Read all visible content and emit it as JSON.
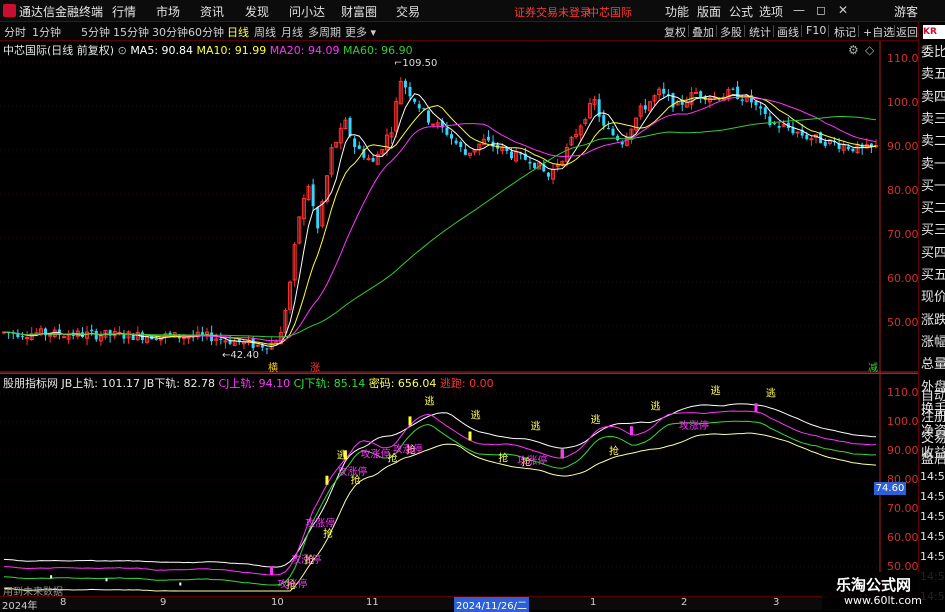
{
  "app": {
    "title": "通达信金融终端"
  },
  "menu": {
    "items": [
      "行情",
      "市场",
      "资讯",
      "发现",
      "问小达",
      "财富圈",
      "交易"
    ],
    "warning": "证券交易未登录",
    "stock_link": "中芯国际",
    "right_items": [
      "功能",
      "版面",
      "公式",
      "选项"
    ],
    "guest": "游客"
  },
  "periods": {
    "tabs": [
      "分时",
      "1分钟",
      "5分钟",
      "15分钟",
      "30分钟",
      "60分钟",
      "日线",
      "周线",
      "月线",
      "多周期",
      "更多"
    ],
    "active": "日线"
  },
  "toolbar_right": [
    "复权",
    "叠加",
    "多股",
    "统计",
    "画线",
    "F10",
    "标记",
    "+自选",
    "返回"
  ],
  "main_legend": {
    "name": "中芯国际(日线 前复权)",
    "ma5": "MA5: 90.84",
    "ma10": "MA10: 91.99",
    "ma20": "MA20: 94.09",
    "ma60": "MA60: 96.90"
  },
  "price_axis": [
    "110.0",
    "100.0",
    "90.00",
    "80.00",
    "70.00",
    "60.00",
    "50.00"
  ],
  "annotations": {
    "high": "109.50",
    "low": "42.40",
    "tag1": "横",
    "tag2": "涨",
    "tag3": "减"
  },
  "sub_legend": {
    "name": "股朋指标网",
    "jb_up": "JB上轨: 101.17",
    "jb_down": "JB下轨: 82.78",
    "cj_up": "CJ上轨: 94.10",
    "cj_down": "CJ下轨: 85.14",
    "secret": "密码: 656.04",
    "escape": "逃跑: 0.00"
  },
  "sub_axis": [
    "110.0",
    "100.0",
    "90.00",
    "80.00",
    "70.00",
    "60.00",
    "50.00"
  ],
  "sub_value_box": "74.60",
  "sub_labels": {
    "escape": "逃",
    "buy": "抢",
    "chase": "攻涨停"
  },
  "dates": [
    "2024年",
    "8",
    "9",
    "10",
    "11",
    "2024/11/26/二",
    "1",
    "2",
    "3"
  ],
  "right_panel": {
    "badge": "KR",
    "rows": [
      "委比",
      "卖五",
      "卖四",
      "卖三",
      "卖二",
      "卖一",
      "买一",
      "买二",
      "买三",
      "买四",
      "买五",
      "现价",
      "涨跌",
      "涨幅",
      "总量",
      "外盘",
      "换手",
      "净资",
      "收益"
    ],
    "lower_rows": [
      "自动",
      "注册",
      "交易",
      "盘后"
    ],
    "times": [
      "14:5",
      "14:5",
      "14:5",
      "14:5",
      "14:5",
      "14:5",
      "14:5"
    ]
  },
  "watermark": {
    "title": "乐淘公式网",
    "url": "www.60lt.com"
  },
  "bottom_note": "用到未来数据",
  "colors": {
    "up": "#ff3333",
    "down": "#33d6ff",
    "ma5": "#ffffff",
    "ma10": "#ffff33",
    "ma20": "#ff33ff",
    "ma60": "#33cc33",
    "axis": "#d33030"
  }
}
